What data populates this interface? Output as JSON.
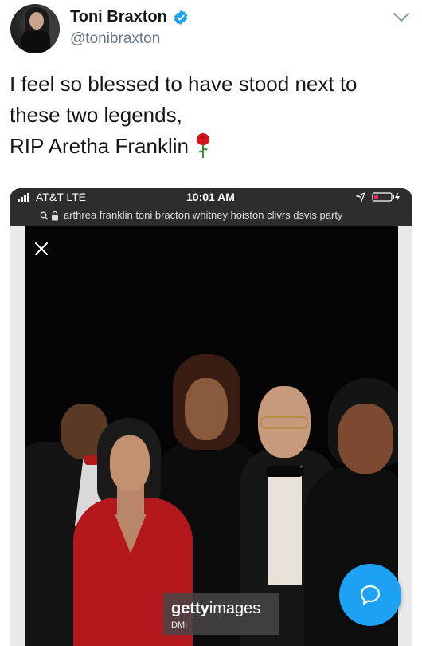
{
  "header": {
    "display_name": "Toni Braxton",
    "handle": "@tonibraxton"
  },
  "tweet": {
    "lines": [
      "I feel so blessed to have stood next to",
      "these two legends,",
      "RIP Aretha Franklin"
    ],
    "emoji_icon": "rose-icon"
  },
  "media": {
    "status_bar": {
      "carrier": "AT&T  LTE",
      "time": "10:01 AM"
    },
    "url_bar": {
      "text": "arthrea franklin toni bracton whitney hoiston clivrs dsvis party"
    },
    "watermark": {
      "brand_bold": "getty",
      "brand_regular": "images",
      "credit": "DMI"
    }
  },
  "colors": {
    "brand_blue": "#1da1f2",
    "text_primary": "#14171a",
    "text_secondary": "#657786"
  }
}
